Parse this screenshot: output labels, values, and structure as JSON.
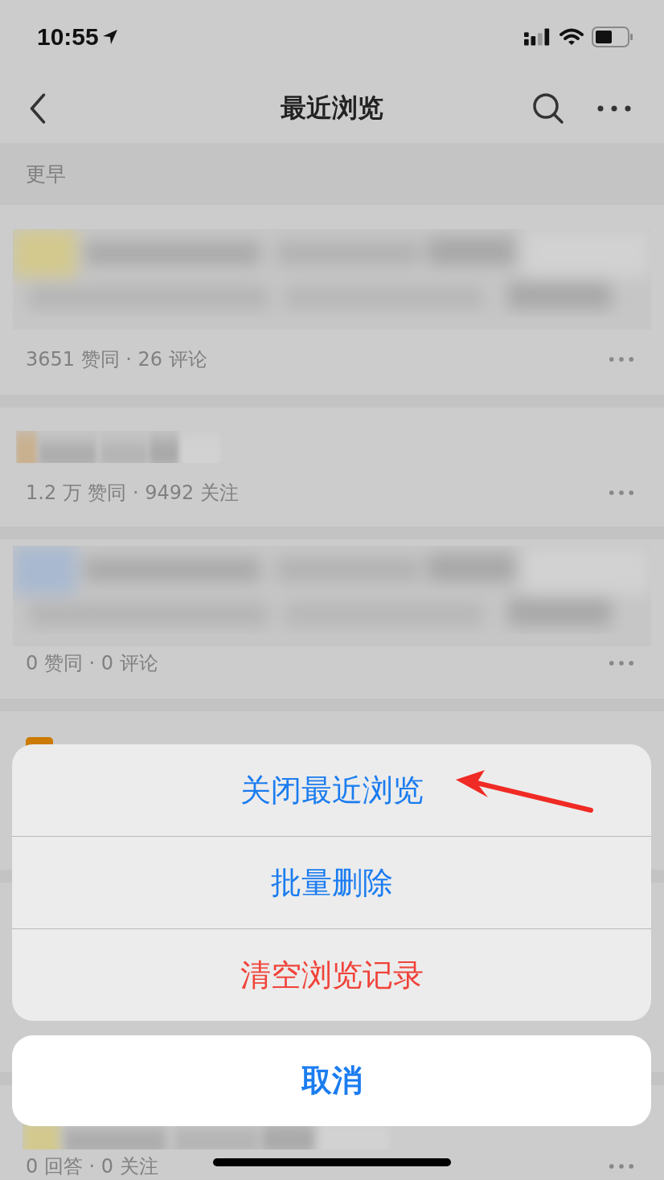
{
  "status_bar": {
    "time": "10:55"
  },
  "nav": {
    "title": "最近浏览"
  },
  "section": {
    "label": "更早"
  },
  "items": [
    {
      "kind": "wide",
      "meta": "3651 赞同 · 26 评论"
    },
    {
      "kind": "short",
      "meta": "1.2 万 赞同 · 9492 关注"
    },
    {
      "kind": "wide",
      "meta": "0 赞同 · 0 评论"
    },
    {
      "kind": "covered"
    },
    {
      "kind": "covered"
    },
    {
      "kind": "short",
      "meta": "0 回答 · 0 关注"
    }
  ],
  "action_sheet": {
    "actions": [
      {
        "label": "关闭最近浏览",
        "kind": "default"
      },
      {
        "label": "批量删除",
        "kind": "default"
      },
      {
        "label": "清空浏览记录",
        "kind": "destructive"
      }
    ],
    "cancel": {
      "label": "取消"
    }
  }
}
